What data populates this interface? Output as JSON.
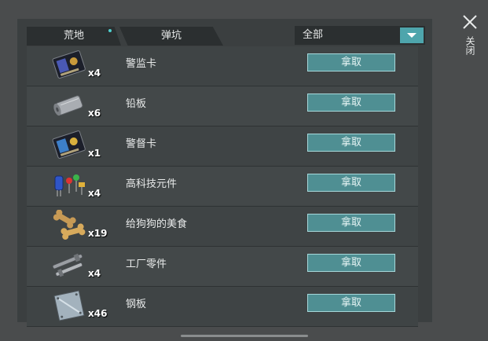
{
  "tabs": [
    {
      "label": "荒地",
      "notification_dot": true
    },
    {
      "label": "弹坑",
      "notification_dot": false
    }
  ],
  "filter": {
    "selected": "全部",
    "icon": "chevron-down-icon"
  },
  "close": {
    "label": "关闭",
    "icon": "close-icon"
  },
  "take_label": "拿取",
  "items": [
    {
      "name": "警监卡",
      "count": "x4",
      "icon": "police-card-icon"
    },
    {
      "name": "铅板",
      "count": "x6",
      "icon": "lead-sheet-icon"
    },
    {
      "name": "警督卡",
      "count": "x1",
      "icon": "police-card-icon"
    },
    {
      "name": "高科技元件",
      "count": "x4",
      "icon": "hightech-components-icon"
    },
    {
      "name": "给狗狗的美食",
      "count": "x19",
      "icon": "dog-treat-icon"
    },
    {
      "name": "工厂零件",
      "count": "x4",
      "icon": "factory-parts-icon"
    },
    {
      "name": "钢板",
      "count": "x46",
      "icon": "steel-plate-icon"
    }
  ],
  "colors": {
    "accent": "#4ea5ac",
    "button": "#4f8f93",
    "panel": "#3b3f40"
  }
}
